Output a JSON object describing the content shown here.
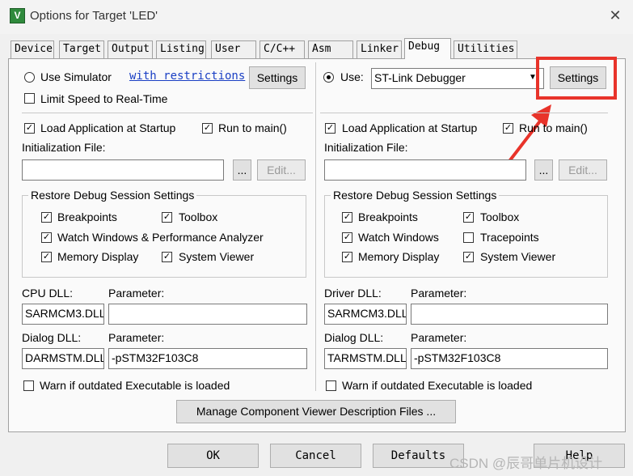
{
  "window": {
    "title": "Options for Target 'LED'"
  },
  "tabs": [
    "Device",
    "Target",
    "Output",
    "Listing",
    "User",
    "C/C++",
    "Asm",
    "Linker",
    "Debug",
    "Utilities"
  ],
  "left": {
    "use_simulator": "Use Simulator",
    "with_restrictions": "with restrictions",
    "settings": "Settings",
    "limit_speed": "Limit Speed to Real-Time",
    "load_app": "Load Application at Startup",
    "run_to_main": "Run to main()",
    "init_file_label": "Initialization File:",
    "browse": "...",
    "edit": "Edit...",
    "restore_group": "Restore Debug Session Settings",
    "breakpoints": "Breakpoints",
    "toolbox": "Toolbox",
    "watch_windows": "Watch Windows & Performance Analyzer",
    "memory_display": "Memory Display",
    "system_viewer": "System Viewer",
    "cpu_dll_label": "CPU DLL:",
    "cpu_param_label": "Parameter:",
    "cpu_dll": "SARMCM3.DLL",
    "cpu_param": "",
    "dialog_dll_label": "Dialog DLL:",
    "dialog_param_label": "Parameter:",
    "dialog_dll": "DARMSTM.DLL",
    "dialog_param": "-pSTM32F103C8",
    "warn": "Warn if outdated Executable is loaded"
  },
  "right": {
    "use": "Use:",
    "debugger": "ST-Link Debugger",
    "settings": "Settings",
    "load_app": "Load Application at Startup",
    "run_to_main": "Run to main()",
    "init_file_label": "Initialization File:",
    "browse": "...",
    "edit": "Edit...",
    "restore_group": "Restore Debug Session Settings",
    "breakpoints": "Breakpoints",
    "toolbox": "Toolbox",
    "watch_windows": "Watch Windows",
    "tracepoints": "Tracepoints",
    "memory_display": "Memory Display",
    "system_viewer": "System Viewer",
    "driver_dll_label": "Driver DLL:",
    "driver_param_label": "Parameter:",
    "driver_dll": "SARMCM3.DLL",
    "driver_param": "",
    "dialog_dll_label": "Dialog DLL:",
    "dialog_param_label": "Parameter:",
    "dialog_dll": "TARMSTM.DLL",
    "dialog_param": "-pSTM32F103C8",
    "warn": "Warn if outdated Executable is loaded"
  },
  "manage_button": "Manage Component Viewer Description Files ...",
  "buttons": {
    "ok": "OK",
    "cancel": "Cancel",
    "defaults": "Defaults",
    "help": "Help"
  },
  "checkmark": "✓",
  "watermark": "CSDN @辰哥单片机设计",
  "colors": {
    "highlight": "#e8332a",
    "link": "#1a3fc4"
  }
}
